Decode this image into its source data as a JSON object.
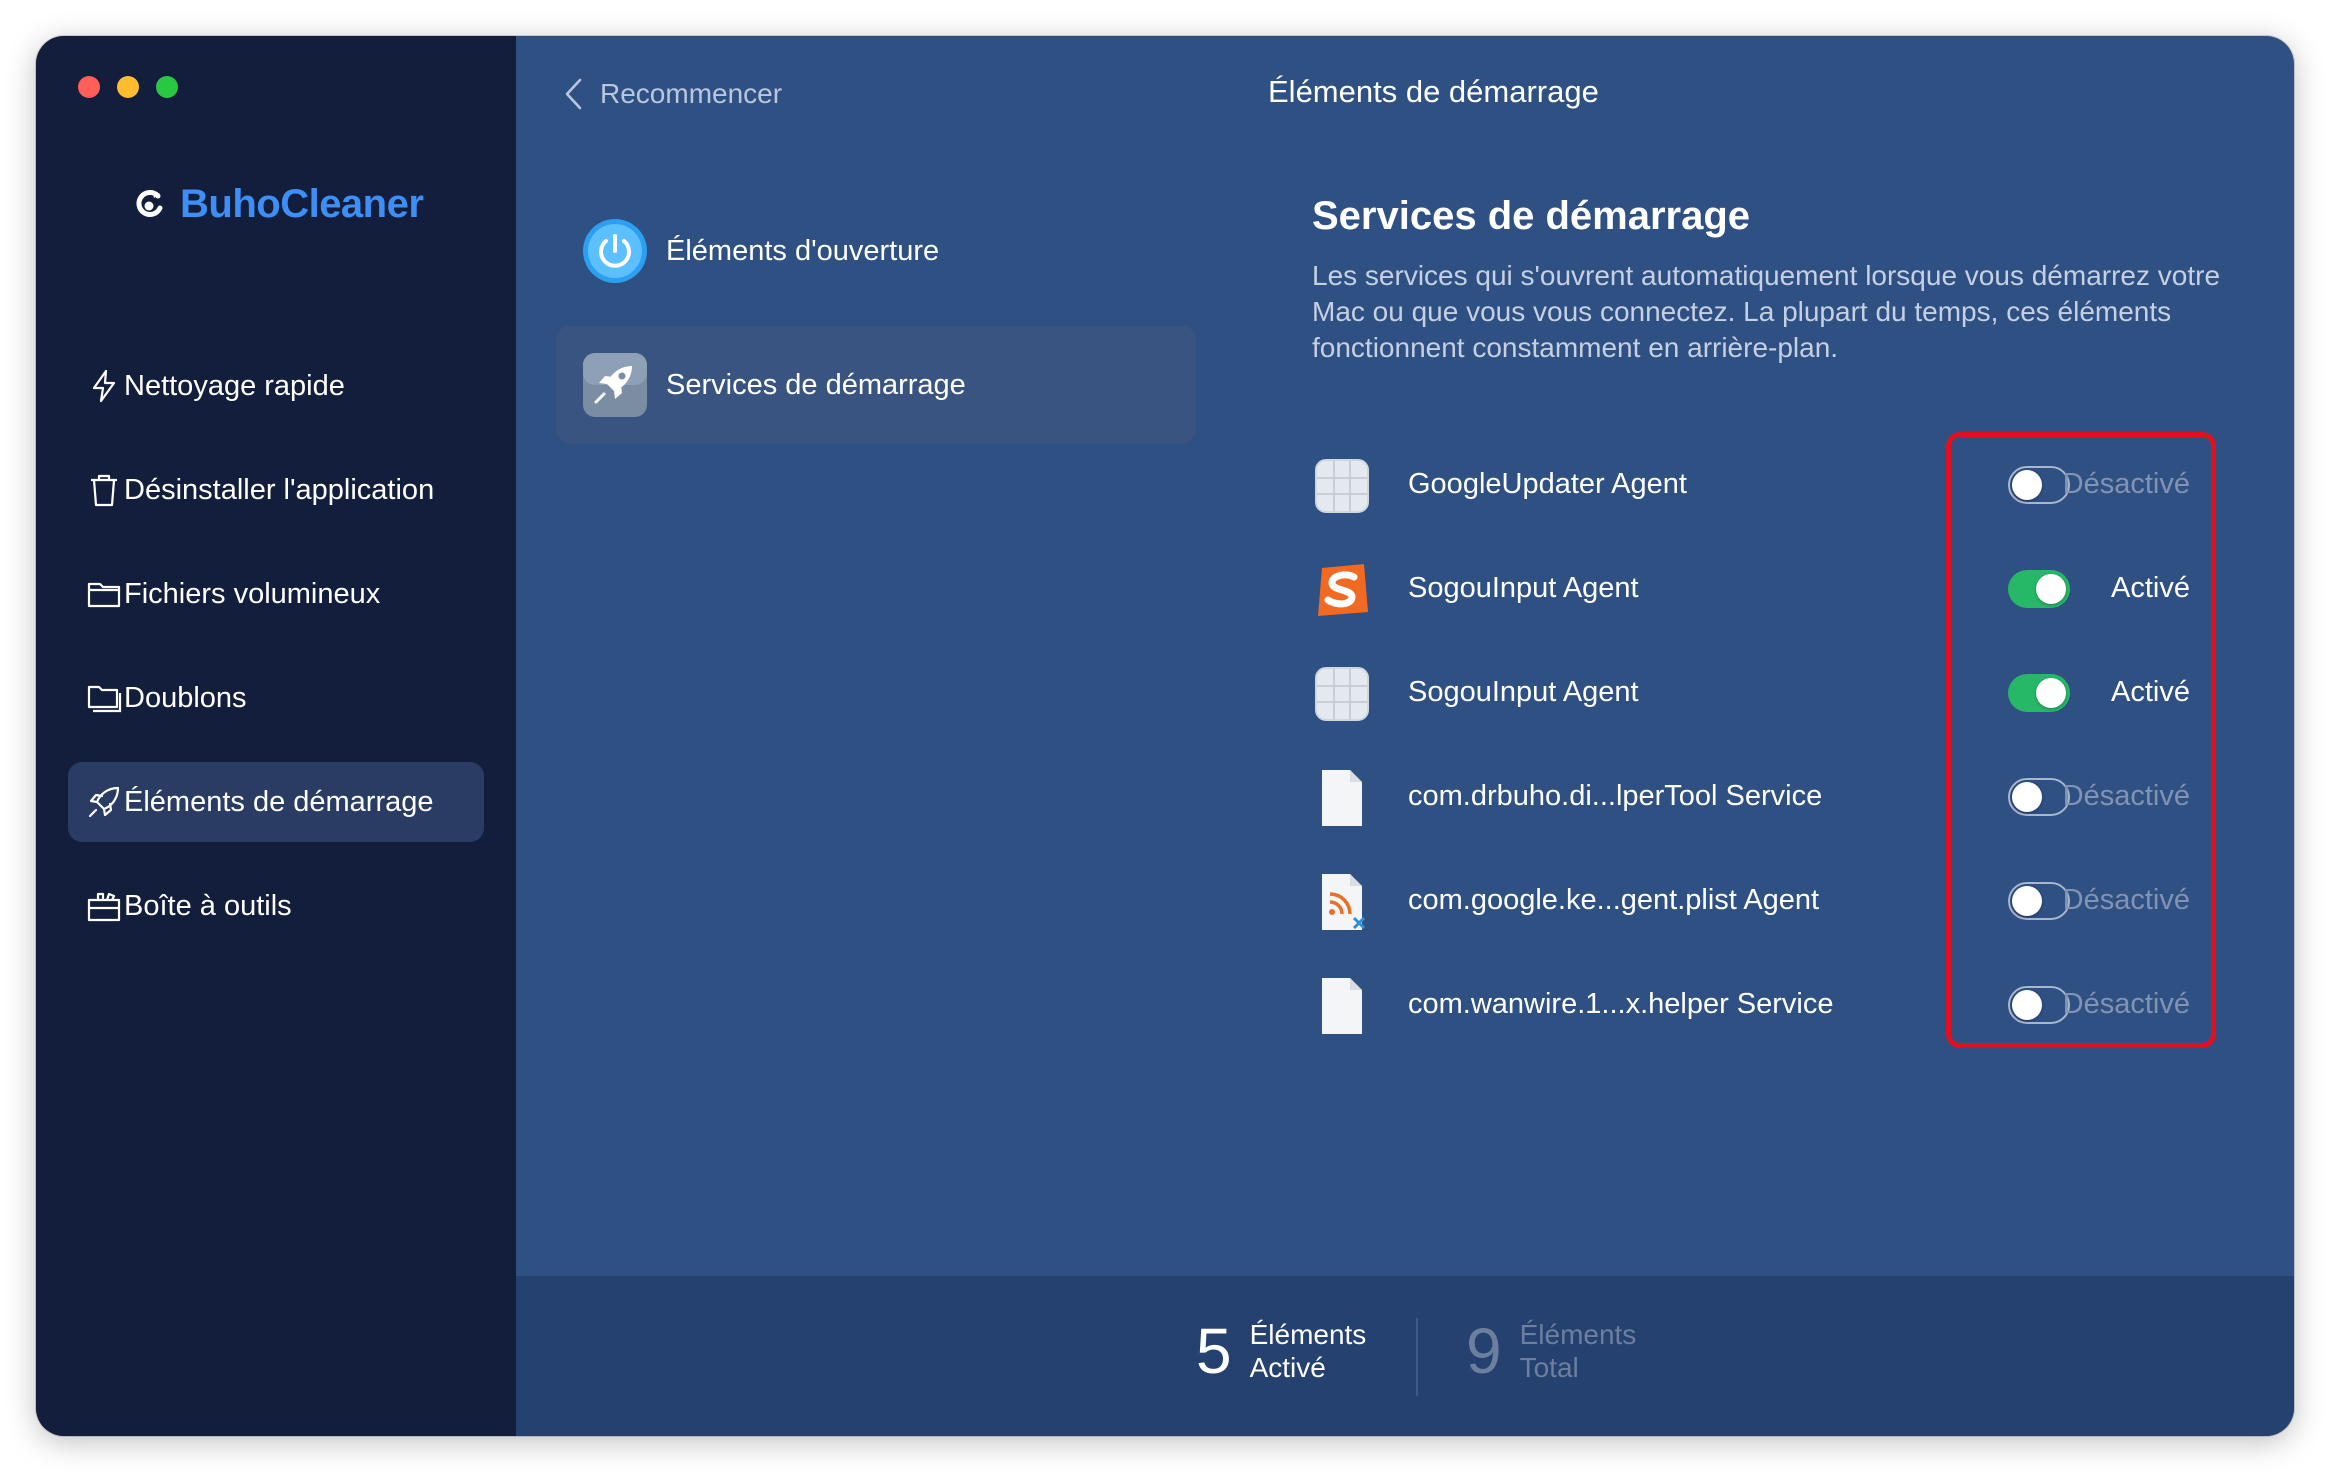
{
  "app": {
    "name": "BuhoCleaner",
    "title": "Éléments de démarrage",
    "brand_color": "#3d8ef5"
  },
  "sidebar": {
    "items": [
      {
        "label": "Nettoyage rapide",
        "icon": "lightning-icon",
        "active": false
      },
      {
        "label": "Désinstaller l'application",
        "icon": "trash-icon",
        "active": false
      },
      {
        "label": "Fichiers volumineux",
        "icon": "folder-icon",
        "active": false
      },
      {
        "label": "Doublons",
        "icon": "duplicate-folder-icon",
        "active": false
      },
      {
        "label": "Éléments de démarrage",
        "icon": "rocket-icon",
        "active": true
      },
      {
        "label": "Boîte à outils",
        "icon": "toolbox-icon",
        "active": false
      }
    ]
  },
  "topbar": {
    "back_label": "Recommencer",
    "back_icon": "chevron-left-icon"
  },
  "categories": [
    {
      "label": "Éléments d'ouverture",
      "icon": "power-icon",
      "active": false
    },
    {
      "label": "Services de démarrage",
      "icon": "rocket-app-icon",
      "active": true
    }
  ],
  "detail": {
    "title": "Services de démarrage",
    "description": "Les services qui s'ouvrent automatiquement lorsque vous démarrez votre Mac ou que vous vous connectez. La plupart du temps, ces éléments fonctionnent constamment en arrière-plan."
  },
  "services": [
    {
      "name": "GoogleUpdater Agent",
      "icon": "generic-app-icon",
      "enabled": false,
      "status": "Désactivé"
    },
    {
      "name": "SogouInput Agent",
      "icon": "sogou-icon",
      "enabled": true,
      "status": "Activé"
    },
    {
      "name": "SogouInput Agent",
      "icon": "generic-app-icon",
      "enabled": true,
      "status": "Activé"
    },
    {
      "name": "com.drbuho.di...lperTool Service",
      "icon": "document-icon",
      "enabled": false,
      "status": "Désactivé"
    },
    {
      "name": "com.google.ke...gent.plist Agent",
      "icon": "plist-file-icon",
      "enabled": false,
      "status": "Désactivé"
    },
    {
      "name": "com.wanwire.1...x.helper Service",
      "icon": "document-icon",
      "enabled": false,
      "status": "Désactivé"
    }
  ],
  "footer": {
    "active_count": "5",
    "active_label_1": "Éléments",
    "active_label_2": "Activé",
    "total_count": "9",
    "total_label_1": "Éléments",
    "total_label_2": "Total"
  },
  "colors": {
    "toggle_on": "#27b867",
    "highlight": "#e2101d"
  }
}
